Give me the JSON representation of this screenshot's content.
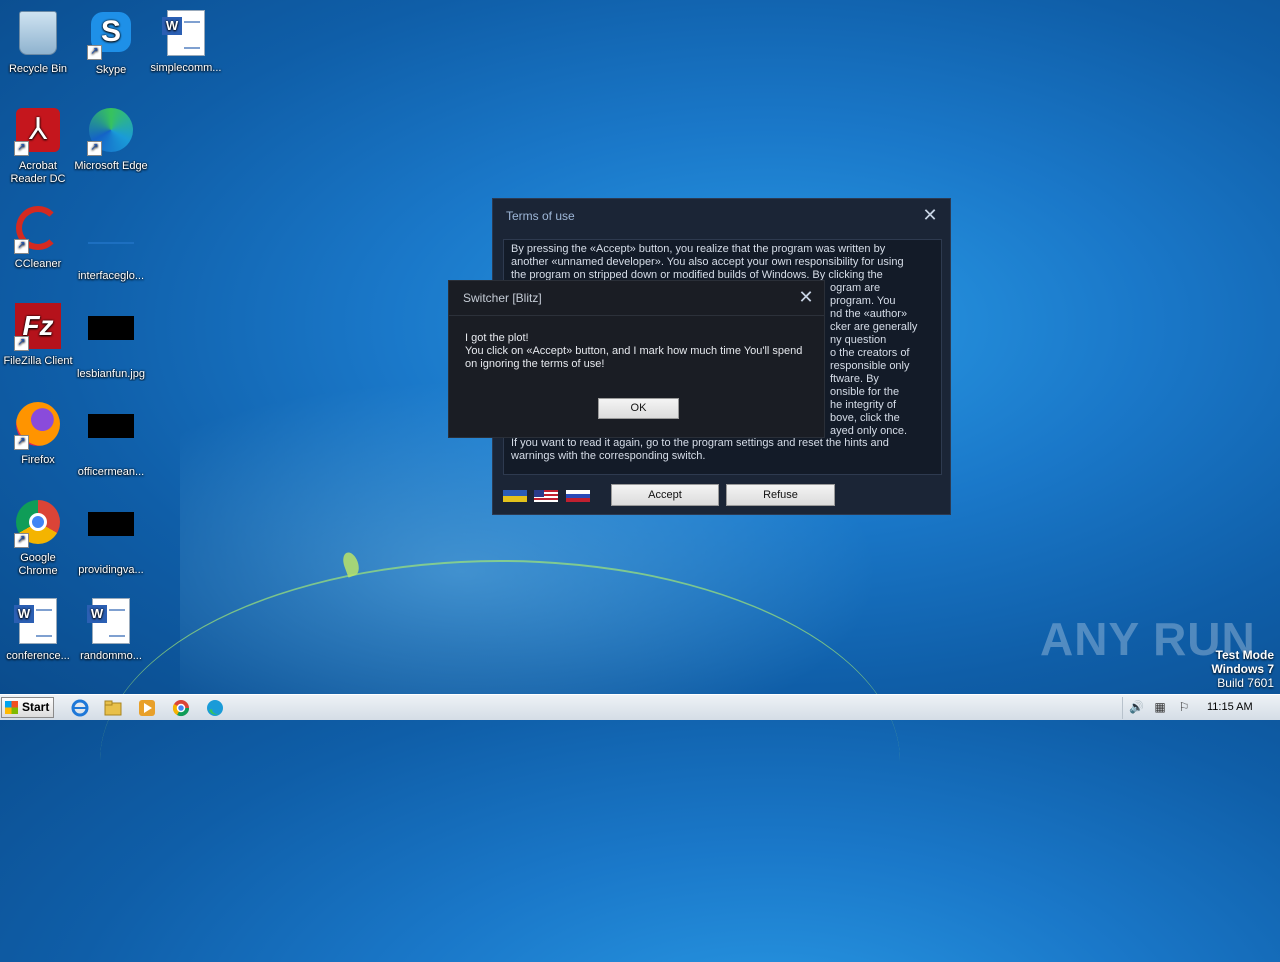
{
  "desktop": {
    "icons": [
      {
        "label": "Recycle Bin"
      },
      {
        "label": "Skype"
      },
      {
        "label": "simplecomm..."
      },
      {
        "label": "Acrobat Reader DC"
      },
      {
        "label": "Microsoft Edge"
      },
      {
        "label": "CCleaner"
      },
      {
        "label": "interfaceglo..."
      },
      {
        "label": "FileZilla Client"
      },
      {
        "label": "lesbianfun.jpg"
      },
      {
        "label": "Firefox"
      },
      {
        "label": "officermean..."
      },
      {
        "label": "Google Chrome"
      },
      {
        "label": "providingva..."
      },
      {
        "label": "conference..."
      },
      {
        "label": "randommo..."
      }
    ]
  },
  "terms_window": {
    "title": "Terms of use",
    "text_top": "By pressing the «Accept» button, you realize that the program was written by another «unnamed developer». You also accept your own responsibility for using the program on stripped down or modified builds of Windows. By clicking the",
    "partial_lines": [
      "ogram are",
      "program. You",
      "nd the «author»",
      "cker are generally",
      "ny question",
      "o the creators of",
      "responsible only",
      "ftware. By",
      "onsible for the",
      "he integrity of",
      "bove, click the",
      "ayed only once."
    ],
    "text_bottom": "If you want to read it again, go to the program settings and reset the hints and warnings with the corresponding switch.",
    "accept_label": "Accept",
    "refuse_label": "Refuse"
  },
  "switcher_dialog": {
    "title": "Switcher [Blitz]",
    "line1": "I got the plot!",
    "line2": "You click on «Accept» button, and I mark how much time You'll spend on ignoring the terms of use!",
    "ok_label": "OK"
  },
  "watermark": {
    "brand": "ANY RUN",
    "test_mode": "Test Mode",
    "os": "Windows 7",
    "build": "Build 7601"
  },
  "taskbar": {
    "start_label": "Start",
    "clock": "11:15 AM"
  }
}
